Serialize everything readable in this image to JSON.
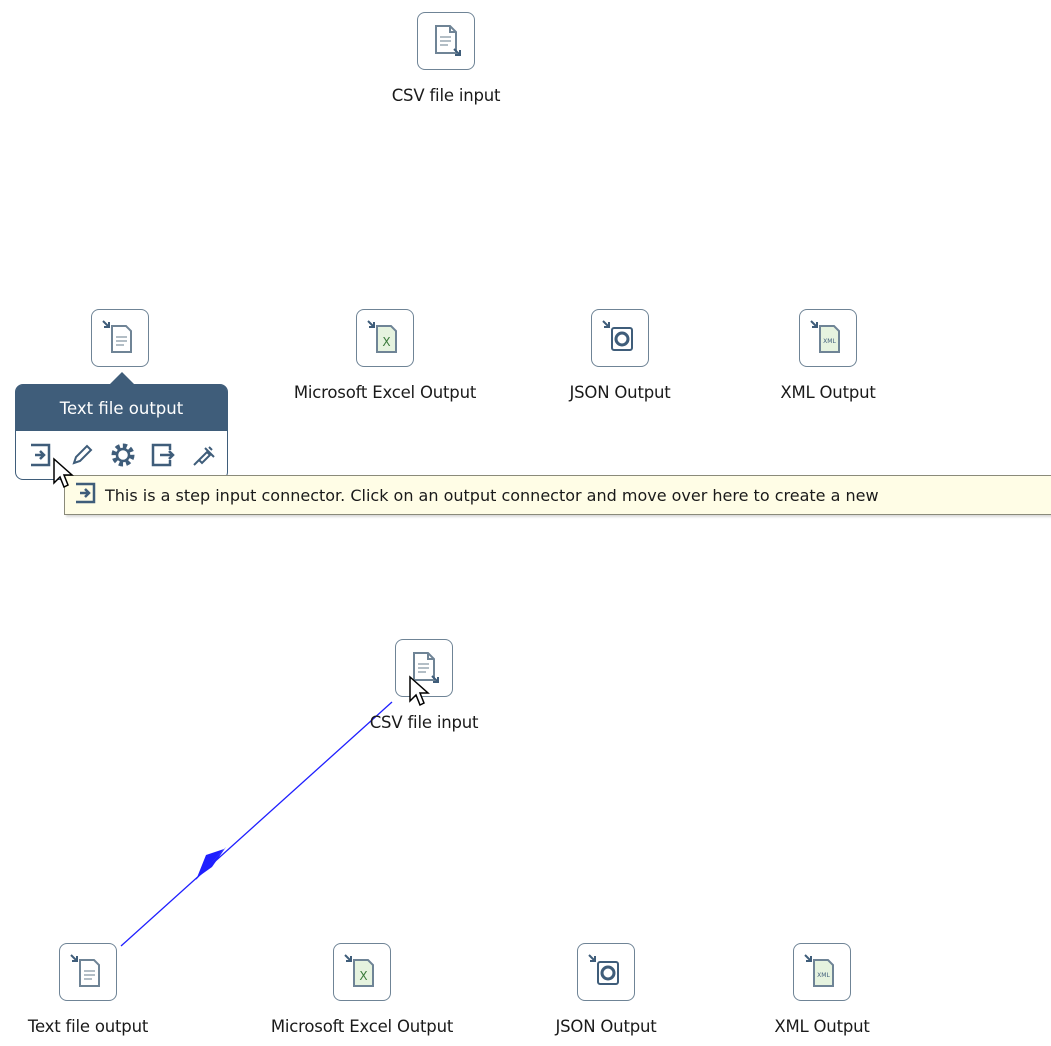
{
  "canvas_top": {
    "csv_input": {
      "label": "CSV file input",
      "icon": "csv-file-input-icon"
    },
    "text_output": {
      "label": "Text file output",
      "icon": "text-file-output-icon"
    },
    "excel_output": {
      "label": "Microsoft Excel Output",
      "icon": "excel-output-icon"
    },
    "json_output": {
      "label": "JSON Output",
      "icon": "json-output-icon"
    },
    "xml_output": {
      "label": "XML Output",
      "icon": "xml-output-icon"
    }
  },
  "hover_menu": {
    "title": "Text file output",
    "actions": [
      "input-connector-icon",
      "edit-icon",
      "settings-icon",
      "output-connector-icon",
      "inject-icon"
    ]
  },
  "tooltip": {
    "text": "This is a step input connector. Click on an output connector and move over here to create a new"
  },
  "canvas_bottom": {
    "csv_input": {
      "label": "CSV file input"
    },
    "text_output": {
      "label": "Text file output"
    },
    "excel_output": {
      "label": "Microsoft Excel Output"
    },
    "json_output": {
      "label": "JSON Output"
    },
    "xml_output": {
      "label": "XML Output"
    }
  },
  "colors": {
    "hop": "#1f1fff",
    "step_border": "#6f8496",
    "panel": "#3f5d7a",
    "tooltip_bg": "#fffde6"
  }
}
